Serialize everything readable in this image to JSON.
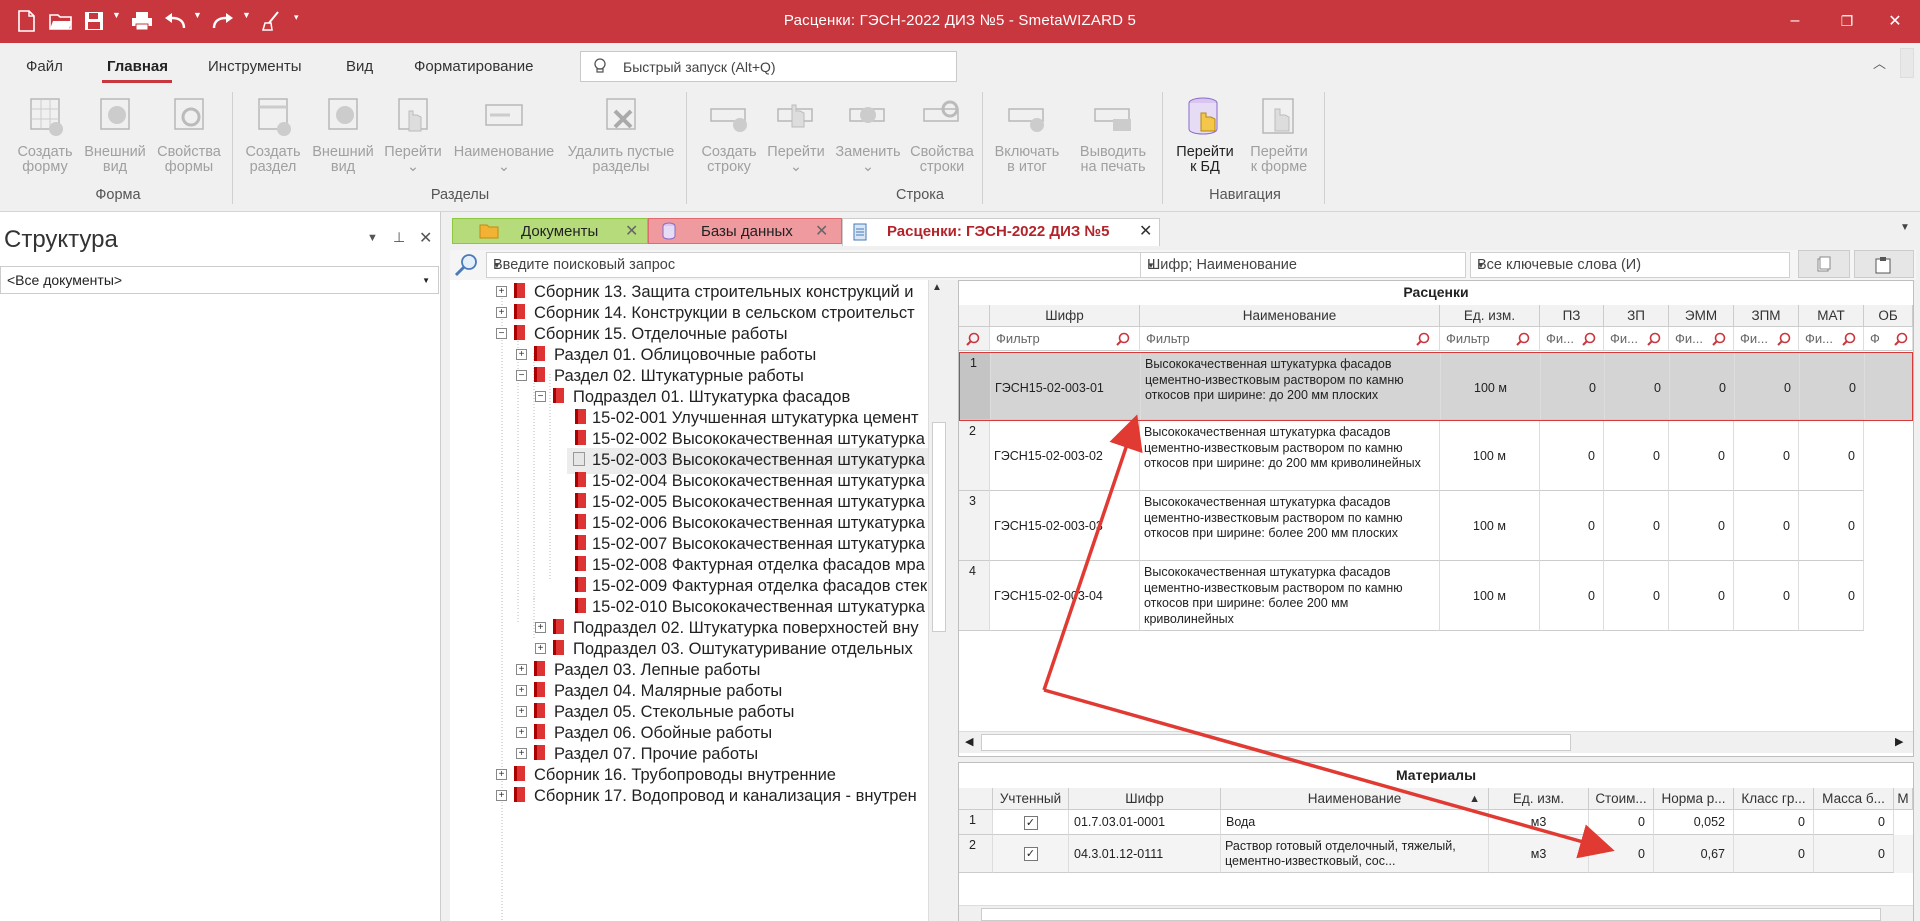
{
  "window": {
    "title": "Расценки: ГЭСН-2022 ДИЗ №5 - SmetaWIZARD 5",
    "minimize": "–",
    "restore": "❐",
    "close": "✕"
  },
  "menu": {
    "items": [
      "Файл",
      "Главная",
      "Инструменты",
      "Вид",
      "Форматирование"
    ],
    "quick_launch": "Быстрый запуск (Alt+Q)"
  },
  "ribbon": {
    "buttons": [
      {
        "l1": "Создать",
        "l2": "форму"
      },
      {
        "l1": "Внешний",
        "l2": "вид"
      },
      {
        "l1": "Свойства",
        "l2": "формы"
      },
      {
        "l1": "Создать",
        "l2": "раздел"
      },
      {
        "l1": "Внешний",
        "l2": "вид"
      },
      {
        "l1": "Перейти",
        "l2": ""
      },
      {
        "l1": "Наименование",
        "l2": ""
      },
      {
        "l1": "Удалить пустые",
        "l2": "разделы"
      },
      {
        "l1": "Создать",
        "l2": "строку"
      },
      {
        "l1": "Перейти",
        "l2": ""
      },
      {
        "l1": "Заменить",
        "l2": ""
      },
      {
        "l1": "Свойства",
        "l2": "строки"
      },
      {
        "l1": "Включать",
        "l2": "в итог"
      },
      {
        "l1": "Выводить",
        "l2": "на печать"
      },
      {
        "l1": "Перейти",
        "l2": "к БД"
      },
      {
        "l1": "Перейти",
        "l2": "к форме"
      }
    ],
    "groups": [
      "Форма",
      "Разделы",
      "Строка",
      "Навигация"
    ]
  },
  "structure": {
    "title": "Структура",
    "combo": "<Все документы>"
  },
  "doc_tabs": [
    "Документы",
    "Базы данных",
    "Расценки: ГЭСН-2022 ДИЗ №5"
  ],
  "search": {
    "placeholder": "Введите поисковый запрос",
    "field": "Шифр; Наименование",
    "mode": "Все ключевые слова (И)"
  },
  "tree": [
    "Сборник 13. Защита строительных конструкций и",
    "Сборник 14. Конструкции в сельском строительст",
    "Сборник 15. Отделочные работы",
    "Раздел 01. Облицовочные работы",
    "Раздел 02. Штукатурные работы",
    "Подраздел 01. Штукатурка фасадов",
    "15-02-001 Улучшенная штукатурка цемент",
    "15-02-002 Высококачественная штукатурка",
    "15-02-003 Высококачественная штукатурка",
    "15-02-004 Высококачественная штукатурка",
    "15-02-005 Высококачественная штукатурка",
    "15-02-006 Высококачественная штукатурка",
    "15-02-007 Высококачественная штукатурка",
    "15-02-008 Фактурная отделка фасадов мра",
    "15-02-009 Фактурная отделка фасадов стек",
    "15-02-010 Высококачественная штукатурка",
    "Подраздел 02. Штукатурка поверхностей вну",
    "Подраздел 03. Оштукатуривание отдельных",
    "Раздел 03. Лепные работы",
    "Раздел 04. Малярные работы",
    "Раздел 05. Стекольные работы",
    "Раздел 06. Обойные работы",
    "Раздел 07. Прочие работы",
    "Сборник 16. Трубопроводы внутренние",
    "Сборник 17. Водопровод и канализация - внутрен"
  ],
  "rates": {
    "title": "Расценки",
    "columns": [
      "Шифр",
      "Наименование",
      "Ед. изм.",
      "ПЗ",
      "ЗП",
      "ЭММ",
      "ЗПМ",
      "МАТ",
      "ОБ"
    ],
    "filters": [
      "Фильтр",
      "Фильтр",
      "Фильтр",
      "Фи...",
      "Фи...",
      "Фи...",
      "Фи...",
      "Фи...",
      "Ф"
    ],
    "rows": [
      {
        "n": "1",
        "code": "ГЭСН15-02-003-01",
        "name": "Высококачественная штукатурка фасадов цементно-известковым раствором по камню откосов при ширине: до 200 мм плоских",
        "unit": "100 м",
        "v": [
          "0",
          "0",
          "0",
          "0",
          "0"
        ]
      },
      {
        "n": "2",
        "code": "ГЭСН15-02-003-02",
        "name": "Высококачественная штукатурка фасадов цементно-известковым раствором по камню откосов при ширине: до 200 мм криволинейных",
        "unit": "100 м",
        "v": [
          "0",
          "0",
          "0",
          "0",
          "0"
        ]
      },
      {
        "n": "3",
        "code": "ГЭСН15-02-003-03",
        "name": "Высококачественная штукатурка фасадов цементно-известковым раствором по камню откосов при ширине: более 200 мм плоских",
        "unit": "100 м",
        "v": [
          "0",
          "0",
          "0",
          "0",
          "0"
        ]
      },
      {
        "n": "4",
        "code": "ГЭСН15-02-003-04",
        "name": "Высококачественная штукатурка фасадов цементно-известковым раствором по камню откосов при ширине: более 200 мм криволинейных",
        "unit": "100 м",
        "v": [
          "0",
          "0",
          "0",
          "0",
          "0"
        ]
      }
    ]
  },
  "materials": {
    "title": "Материалы",
    "columns": [
      "Учтенный",
      "Шифр",
      "Наименование",
      "Ед. изм.",
      "Стоим...",
      "Норма р...",
      "Класс гр...",
      "Масса б...",
      "М"
    ],
    "rows": [
      {
        "n": "1",
        "checked": "✓",
        "code": "01.7.03.01-0001",
        "name": "Вода",
        "unit": "м3",
        "cost": "0",
        "norm": "0,052",
        "cls": "0",
        "mass": "0"
      },
      {
        "n": "2",
        "checked": "✓",
        "code": "04.3.01.12-0111",
        "name": "Раствор готовый отделочный, тяжелый, цементно-известковый, сос...",
        "unit": "м3",
        "cost": "0",
        "norm": "0,67",
        "cls": "0",
        "mass": "0"
      }
    ]
  },
  "colors": {
    "accent": "#c8373e",
    "tab_docs": "#8dc63f",
    "tab_db": "#e06a6f",
    "arrow": "#e03a33"
  }
}
